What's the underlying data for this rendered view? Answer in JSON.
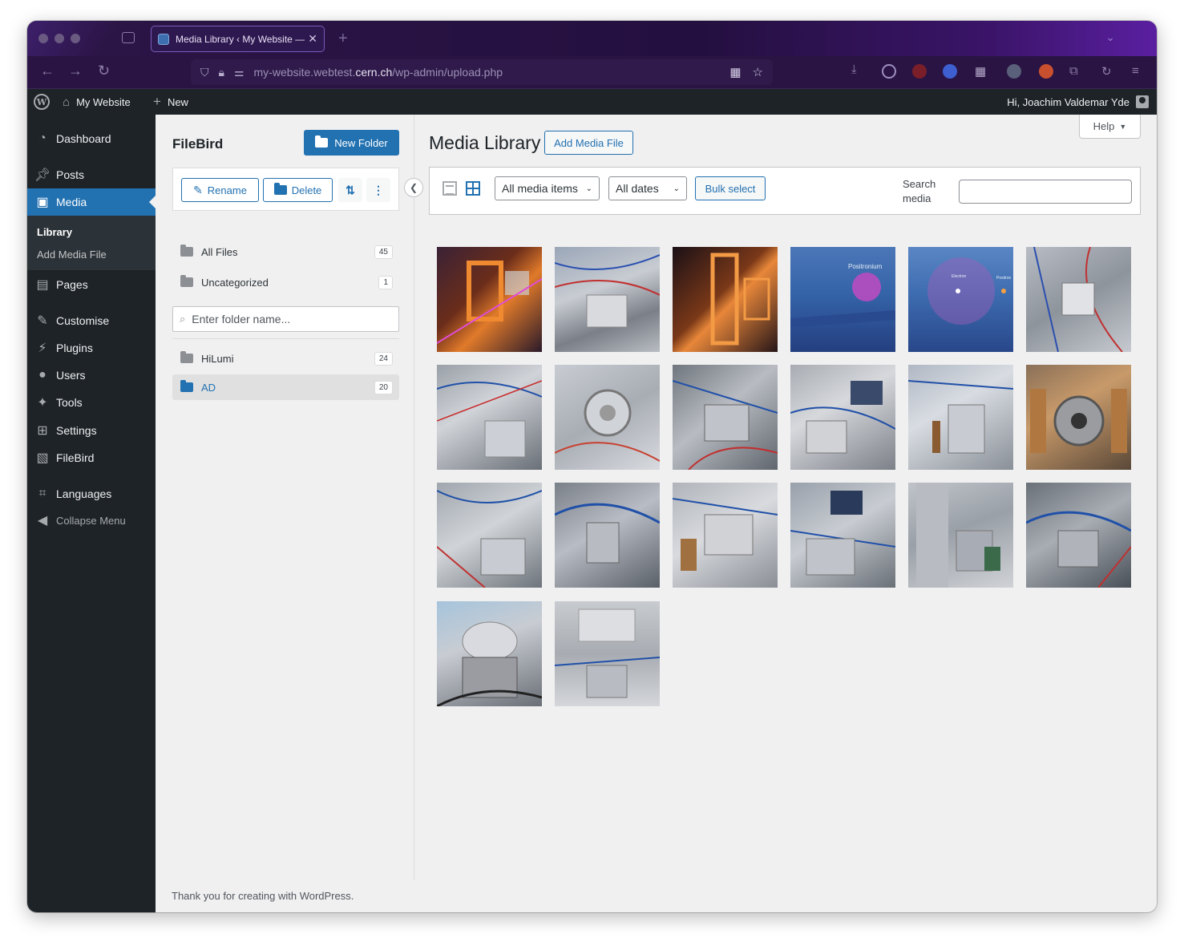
{
  "browser": {
    "tab_title": "Media Library ‹ My Website — W",
    "url_prefix": "my-website.webtest.",
    "url_domain": "cern.ch",
    "url_path": "/wp-admin/upload.php"
  },
  "adminbar": {
    "site_name": "My Website",
    "new_label": "New",
    "greeting": "Hi, Joachim Valdemar Yde"
  },
  "sidebar": {
    "items": [
      {
        "label": "Dashboard",
        "icon": "dashboard-icon"
      },
      {
        "label": "Posts",
        "icon": "pin-icon"
      },
      {
        "label": "Media",
        "icon": "media-icon"
      },
      {
        "label": "Pages",
        "icon": "pages-icon"
      },
      {
        "label": "Customise",
        "icon": "brush-icon"
      },
      {
        "label": "Plugins",
        "icon": "plugin-icon"
      },
      {
        "label": "Users",
        "icon": "user-icon"
      },
      {
        "label": "Tools",
        "icon": "wrench-icon"
      },
      {
        "label": "Settings",
        "icon": "settings-icon"
      },
      {
        "label": "FileBird",
        "icon": "filebird-icon"
      },
      {
        "label": "Languages",
        "icon": "translate-icon"
      }
    ],
    "submenu": {
      "library": "Library",
      "add_media": "Add Media File"
    },
    "collapse": "Collapse Menu"
  },
  "filebird": {
    "title": "FileBird",
    "new_folder": "New Folder",
    "rename": "Rename",
    "delete": "Delete",
    "all_files": {
      "label": "All Files",
      "count": "45"
    },
    "uncategorized": {
      "label": "Uncategorized",
      "count": "1"
    },
    "search_placeholder": "Enter folder name...",
    "folders": [
      {
        "label": "HiLumi",
        "count": "24"
      },
      {
        "label": "AD",
        "count": "20"
      }
    ]
  },
  "main": {
    "title": "Media Library",
    "add_media": "Add Media File",
    "help": "Help",
    "filter_type": "All media items",
    "filter_date": "All dates",
    "bulk_select": "Bulk select",
    "search_label": "Search media",
    "thumb_labels": {
      "positronium": "Positronium",
      "electron": "Electron",
      "positron": "Positron"
    }
  },
  "footer": "Thank you for creating with WordPress.",
  "colors": {
    "accent": "#2271b1",
    "admin_dark": "#1d2327"
  }
}
